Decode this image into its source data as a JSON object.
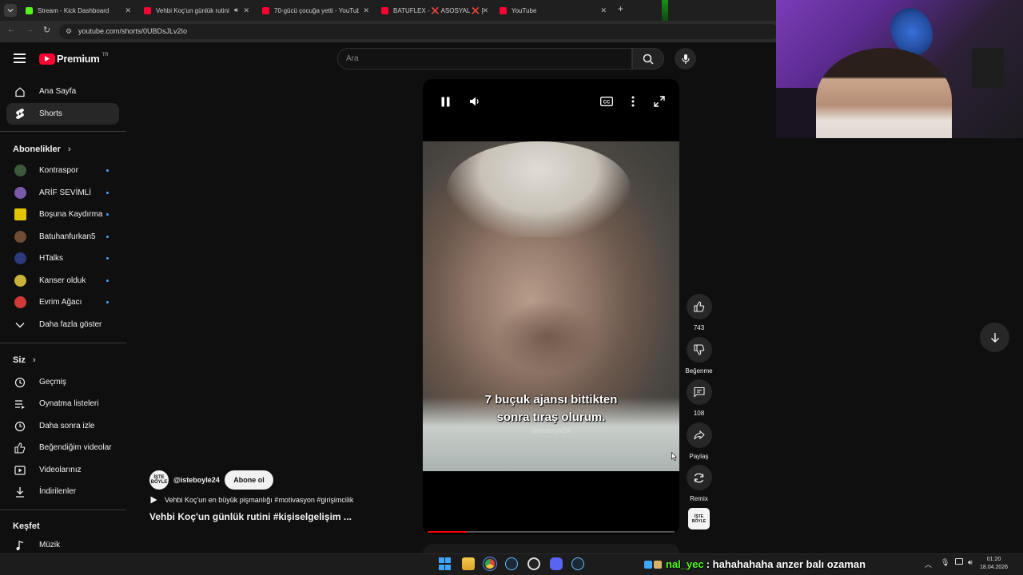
{
  "browser": {
    "tabs": [
      {
        "label": "Stream - Kick Dashboard",
        "favicon_color": "#53fc18"
      },
      {
        "label": "Vehbi Koç'un günlük rutini",
        "favicon_color": "#ff0033"
      },
      {
        "label": "70-gücü çocuğa yetti - YouTube",
        "favicon_color": "#ff0033"
      },
      {
        "label": "BATUFLEX - ❌ ASOSYAL ❌ [...",
        "favicon_color": "#ff0033"
      },
      {
        "label": "YouTube",
        "favicon_color": "#ff0033"
      }
    ],
    "url": "youtube.com/shorts/0UBDsJLv2Io"
  },
  "youtube": {
    "logo_text": "Premium",
    "logo_region": "TR",
    "search_placeholder": "Ara",
    "nav_main": [
      "Ana Sayfa",
      "Shorts"
    ],
    "subscriptions_header": "Abonelikler",
    "subscriptions": [
      {
        "name": "Kontraspor",
        "color": "#3c5a3a"
      },
      {
        "name": "ARİF SEVİMLİ",
        "color": "#7a5aa8"
      },
      {
        "name": "Boşuna Kaydırma",
        "color": "#e3c400"
      },
      {
        "name": "Batuhanfurkan5",
        "color": "#6e4c34"
      },
      {
        "name": "HTalks",
        "color": "#2d3a7c"
      },
      {
        "name": "Kanser olduk",
        "color": "#c9b23a"
      },
      {
        "name": "Evrim Ağacı",
        "color": "#d23a3a"
      }
    ],
    "show_more": "Daha fazla göster",
    "you_header": "Siz",
    "you_items": [
      "Geçmiş",
      "Oynatma listeleri",
      "Daha sonra izle",
      "Beğendiğim videolar",
      "Videolarınız",
      "İndirilenler"
    ],
    "explore_header": "Keşfet",
    "explore_items": [
      "Müzik"
    ]
  },
  "short": {
    "subtitle_line1": "7 buçuk ajansı bittikten",
    "subtitle_line2": "sonra tıraş olurum.",
    "watermark": "@isteboyle24",
    "progress": 0.16,
    "channel_handle": "@isteboyle24",
    "channel_avatar_text": "İŞTE BÖYLE",
    "subscribe_label": "Abone ol",
    "audio_line": "Vehbi Koç'un en büyük pişmanlığı #motivasyon #girişimcilik",
    "title": "Vehbi Koç'un günlük rutini #kişiselgelişim ...",
    "likes": "743",
    "dislike_label": "Beğenme",
    "comments": "108",
    "share_label": "Paylaş",
    "remix_label": "Remix"
  },
  "overlay": {
    "chat_user": "nal_yec",
    "chat_message": ": hahahahaha anzer balı ozaman"
  },
  "system": {
    "time": "01:20",
    "date": "18.04.2026"
  }
}
